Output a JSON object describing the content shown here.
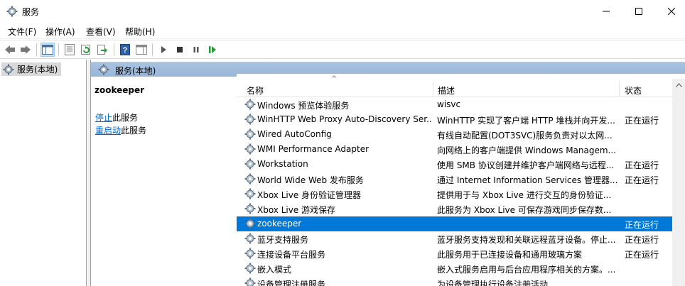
{
  "window": {
    "title": "服务"
  },
  "menu": [
    "文件(F)",
    "操作(A)",
    "查看(V)",
    "帮助(H)"
  ],
  "tree": {
    "root_label": "服务(本地)"
  },
  "panel": {
    "header": "服务(本地)"
  },
  "details": {
    "service_name": "zookeeper",
    "stop_link": "停止",
    "stop_suffix": "此服务",
    "restart_link": "重启动",
    "restart_suffix": "此服务"
  },
  "table": {
    "columns": [
      "名称",
      "描述",
      "状态"
    ],
    "sort_indicator": "^",
    "rows": [
      {
        "name": "Windows 预览体验服务",
        "desc": "wisvc",
        "status": ""
      },
      {
        "name": "WinHTTP Web Proxy Auto-Discovery Ser...",
        "desc": "WinHTTP 实现了客户端 HTTP 堆栈并向开发...",
        "status": "正在运行"
      },
      {
        "name": "Wired AutoConfig",
        "desc": "有线自动配置(DOT3SVC)服务负责对以太网...",
        "status": ""
      },
      {
        "name": "WMI Performance Adapter",
        "desc": "向网络上的客户端提供 Windows Managem...",
        "status": ""
      },
      {
        "name": "Workstation",
        "desc": "使用 SMB 协议创建并维护客户端网络与远程...",
        "status": "正在运行"
      },
      {
        "name": "World Wide Web 发布服务",
        "desc": "通过 Internet Information Services 管理器...",
        "status": "正在运行"
      },
      {
        "name": "Xbox Live 身份验证管理器",
        "desc": "提供用于与 Xbox Live 进行交互的身份验证...",
        "status": ""
      },
      {
        "name": "Xbox Live 游戏保存",
        "desc": "此服务为 Xbox Live 可保存游戏同步保存数...",
        "status": ""
      },
      {
        "name": "zookeeper",
        "desc": "",
        "status": "正在运行"
      },
      {
        "name": "蓝牙支持服务",
        "desc": "蓝牙服务支持发现和关联远程蓝牙设备。停止...",
        "status": "正在运行"
      },
      {
        "name": "连接设备平台服务",
        "desc": "此服务用于已连接设备和通用玻璃方案",
        "status": "正在运行"
      },
      {
        "name": "嵌入模式",
        "desc": "嵌入式服务启用与后台应用程序相关的方案。...",
        "status": ""
      },
      {
        "name": "设备管理注册服务",
        "desc": "为设备管理执行设备注册活动",
        "status": ""
      }
    ],
    "selected_index": 8
  },
  "colors": {
    "selection": "#0078d7",
    "panel_header": "#9ab7d8",
    "link": "#0066cc"
  },
  "icons": [
    "gear-icon",
    "minimize-icon",
    "maximize-icon",
    "close-icon",
    "back-icon",
    "forward-icon",
    "console-tree-icon",
    "properties-icon",
    "refresh-icon",
    "export-icon",
    "help-icon",
    "view-icon",
    "play-icon",
    "stop-icon",
    "pause-icon",
    "resume-icon"
  ]
}
